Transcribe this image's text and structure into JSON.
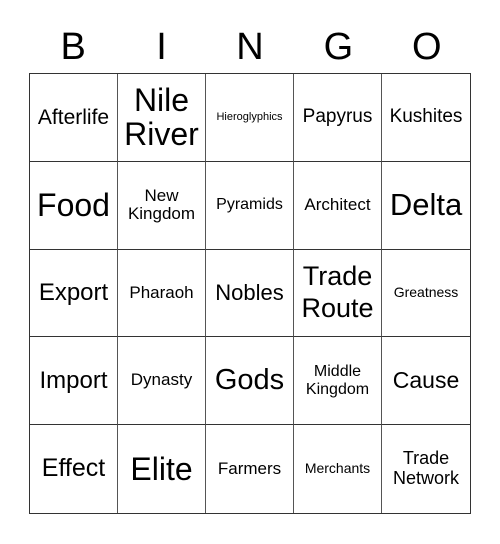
{
  "header": {
    "letters": [
      "B",
      "I",
      "N",
      "G",
      "O"
    ]
  },
  "grid": {
    "rows": [
      [
        {
          "text": "Afterlife",
          "size": "l"
        },
        {
          "text": "Nile River",
          "size": "xxl"
        },
        {
          "text": "Hieroglyphics",
          "size": "xs"
        },
        {
          "text": "Papyrus",
          "size": "m"
        },
        {
          "text": "Kushites",
          "size": "m"
        }
      ],
      [
        {
          "text": "Food",
          "size": "xxl"
        },
        {
          "text": "New Kingdom",
          "size": "m"
        },
        {
          "text": "Pyramids",
          "size": "m"
        },
        {
          "text": "Architect",
          "size": "m"
        },
        {
          "text": "Delta",
          "size": "xxl"
        }
      ],
      [
        {
          "text": "Export",
          "size": "xl"
        },
        {
          "text": "Pharaoh",
          "size": "m"
        },
        {
          "text": "Nobles",
          "size": "l"
        },
        {
          "text": "Trade Route",
          "size": "xxl"
        },
        {
          "text": "Greatness",
          "size": "s"
        }
      ],
      [
        {
          "text": "Import",
          "size": "xl"
        },
        {
          "text": "Dynasty",
          "size": "m"
        },
        {
          "text": "Gods",
          "size": "xxl"
        },
        {
          "text": "Middle Kingdom",
          "size": "m"
        },
        {
          "text": "Cause",
          "size": "xl"
        }
      ],
      [
        {
          "text": "Effect",
          "size": "xl"
        },
        {
          "text": "Elite",
          "size": "xxl"
        },
        {
          "text": "Farmers",
          "size": "m"
        },
        {
          "text": "Merchants",
          "size": "s"
        },
        {
          "text": "Trade Network",
          "size": "m"
        }
      ]
    ]
  }
}
